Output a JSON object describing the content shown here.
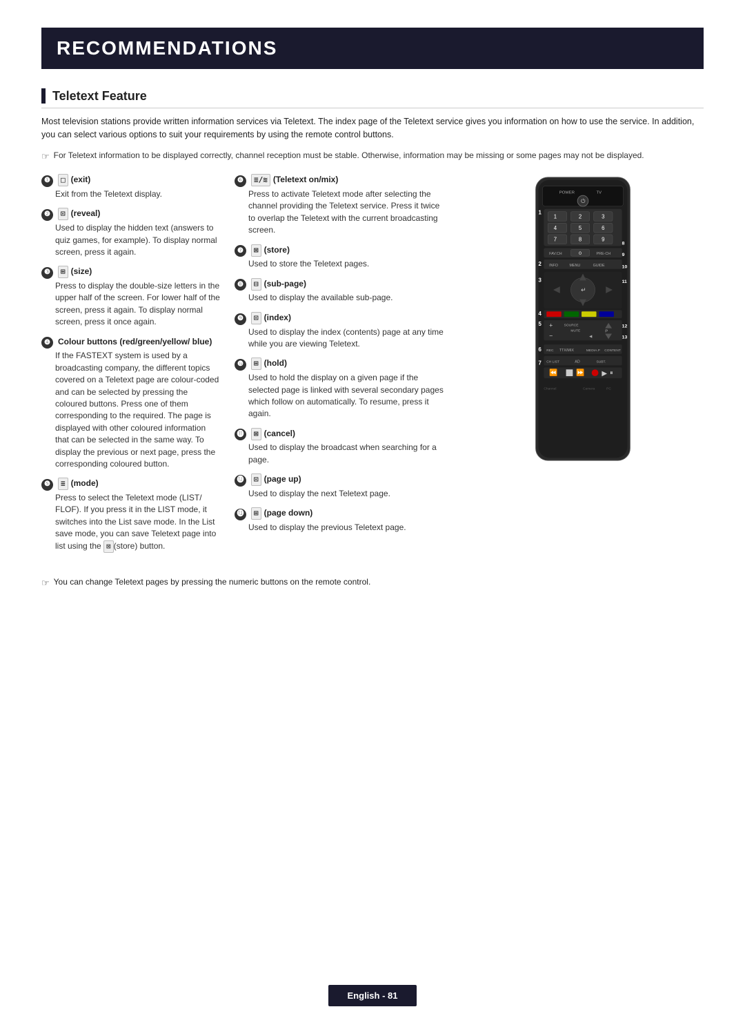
{
  "header": {
    "title": "RECOMMENDATIONS"
  },
  "section": {
    "title": "Teletext Feature"
  },
  "intro": {
    "text": "Most television stations provide written information services via Teletext. The index page of the Teletext service gives you information on how to use the service. In addition, you can select various options to suit your requirements by using the remote control buttons."
  },
  "note1": {
    "icon": "ℹ",
    "text": "For Teletext information to be displayed correctly, channel reception must be stable. Otherwise, information may be missing or some pages may not be displayed."
  },
  "features_left": [
    {
      "num": "1",
      "icon": "(exit)",
      "desc": "Exit from the Teletext display."
    },
    {
      "num": "2",
      "icon": "(reveal)",
      "desc": "Used to display the hidden text (answers to quiz games, for example). To display normal screen, press it again."
    },
    {
      "num": "3",
      "icon": "(size)",
      "desc": "Press to display the double-size letters in the upper half of the screen. For lower half of the screen, press it again. To display normal screen, press it once again."
    },
    {
      "num": "4",
      "icon": "Colour buttons (red/green/yellow/blue)",
      "desc": "If the FASTEXT system is used by a broadcasting company, the different topics covered on a Teletext page are colour-coded and can be selected by pressing the coloured buttons. Press one of them corresponding to the required. The page is displayed with other coloured information that can be selected in the same way. To display the previous or next page, press the corresponding coloured button."
    },
    {
      "num": "5",
      "icon": "(mode)",
      "desc": "Press to select the Teletext mode (LIST/ FLOF). If you press it in the LIST mode, it switches into the List save mode. In the List save mode, you can save Teletext page into list using the (store) button."
    }
  ],
  "features_mid": [
    {
      "num": "6",
      "icon": "(Teletext on/mix)",
      "desc": "Press to activate Teletext mode after selecting the channel providing the Teletext service. Press it twice to overlap the Teletext with the current broadcasting screen."
    },
    {
      "num": "7",
      "icon": "(store)",
      "desc": "Used to store the Teletext pages."
    },
    {
      "num": "8",
      "icon": "(sub-page)",
      "desc": "Used to display the available sub-page."
    },
    {
      "num": "9",
      "icon": "(index)",
      "desc": "Used to display the index (contents) page at any time while you are viewing Teletext."
    },
    {
      "num": "10",
      "icon": "(hold)",
      "desc": "Used to hold the display on a given page if the selected page is linked with several secondary pages which follow on automatically. To resume, press it again."
    },
    {
      "num": "11",
      "icon": "(cancel)",
      "desc": "Used to display the broadcast when searching for a page."
    },
    {
      "num": "12",
      "icon": "(page up)",
      "desc": "Used to display the next Teletext page."
    },
    {
      "num": "13",
      "icon": "(page down)",
      "desc": "Used to display the previous Teletext page."
    }
  ],
  "bottom_note": {
    "icon": "ℹ",
    "text": "You can change Teletext pages by pressing the numeric buttons on the remote control."
  },
  "footer": {
    "label": "English - 81"
  }
}
